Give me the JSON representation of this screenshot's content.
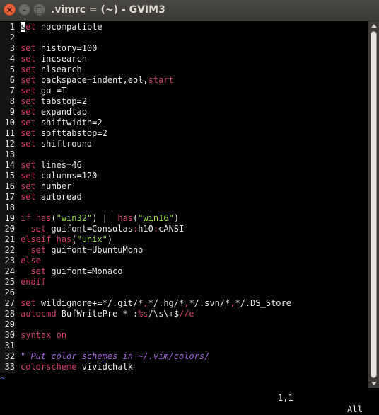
{
  "window": {
    "title": ".vimrc = (~) - GVIM3",
    "close_glyph": "×",
    "minimize_glyph": "–",
    "maximize_glyph": "□"
  },
  "editor": {
    "lines": [
      {
        "n": "1",
        "t": [
          [
            "cur",
            "s"
          ],
          [
            "kw",
            "et"
          ],
          [
            "txt",
            " nocompatible"
          ]
        ]
      },
      {
        "n": "2",
        "t": []
      },
      {
        "n": "3",
        "t": [
          [
            "kw",
            "set"
          ],
          [
            "txt",
            " history=100"
          ]
        ]
      },
      {
        "n": "4",
        "t": [
          [
            "kw",
            "set"
          ],
          [
            "txt",
            " incsearch"
          ]
        ]
      },
      {
        "n": "5",
        "t": [
          [
            "kw",
            "set"
          ],
          [
            "txt",
            " hlsearch"
          ]
        ]
      },
      {
        "n": "6",
        "t": [
          [
            "kw",
            "set"
          ],
          [
            "txt",
            " backspace=indent,eol,"
          ],
          [
            "kw",
            "start"
          ]
        ]
      },
      {
        "n": "7",
        "t": [
          [
            "kw",
            "set"
          ],
          [
            "txt",
            " go-=T"
          ]
        ]
      },
      {
        "n": "8",
        "t": [
          [
            "kw",
            "set"
          ],
          [
            "txt",
            " tabstop=2"
          ]
        ]
      },
      {
        "n": "9",
        "t": [
          [
            "kw",
            "set"
          ],
          [
            "txt",
            " expandtab"
          ]
        ]
      },
      {
        "n": "10",
        "t": [
          [
            "kw",
            "set"
          ],
          [
            "txt",
            " shiftwidth=2"
          ]
        ]
      },
      {
        "n": "11",
        "t": [
          [
            "kw",
            "set"
          ],
          [
            "txt",
            " softtabstop=2"
          ]
        ]
      },
      {
        "n": "12",
        "t": [
          [
            "kw",
            "set"
          ],
          [
            "txt",
            " shiftround"
          ]
        ]
      },
      {
        "n": "13",
        "t": []
      },
      {
        "n": "14",
        "t": [
          [
            "kw",
            "set"
          ],
          [
            "txt",
            " lines=46"
          ]
        ]
      },
      {
        "n": "15",
        "t": [
          [
            "kw",
            "set"
          ],
          [
            "txt",
            " columns=120"
          ]
        ]
      },
      {
        "n": "16",
        "t": [
          [
            "kw",
            "set"
          ],
          [
            "txt",
            " number"
          ]
        ]
      },
      {
        "n": "17",
        "t": [
          [
            "kw",
            "set"
          ],
          [
            "txt",
            " autoread"
          ]
        ]
      },
      {
        "n": "18",
        "t": []
      },
      {
        "n": "19",
        "t": [
          [
            "kw",
            "if"
          ],
          [
            "txt",
            " "
          ],
          [
            "kw",
            "has"
          ],
          [
            "txt",
            "("
          ],
          [
            "str",
            "\"win32\""
          ],
          [
            "txt",
            ") || "
          ],
          [
            "kw",
            "has"
          ],
          [
            "txt",
            "("
          ],
          [
            "str",
            "\"win16\""
          ],
          [
            "txt",
            ")"
          ]
        ]
      },
      {
        "n": "20",
        "t": [
          [
            "txt",
            "  "
          ],
          [
            "kw",
            "set"
          ],
          [
            "txt",
            " guifont=Consolas"
          ],
          [
            "kw",
            ":"
          ],
          [
            "txt",
            "h10"
          ],
          [
            "kw",
            ":"
          ],
          [
            "txt",
            "cANSI"
          ]
        ]
      },
      {
        "n": "21",
        "t": [
          [
            "kw",
            "elseif"
          ],
          [
            "txt",
            " "
          ],
          [
            "kw",
            "has"
          ],
          [
            "txt",
            "("
          ],
          [
            "str",
            "\"unix\""
          ],
          [
            "txt",
            ")"
          ]
        ]
      },
      {
        "n": "22",
        "t": [
          [
            "txt",
            "  "
          ],
          [
            "kw",
            "set"
          ],
          [
            "txt",
            " guifont=UbuntuMono"
          ]
        ]
      },
      {
        "n": "23",
        "t": [
          [
            "kw",
            "else"
          ]
        ]
      },
      {
        "n": "24",
        "t": [
          [
            "txt",
            "  "
          ],
          [
            "kw",
            "set"
          ],
          [
            "txt",
            " guifont=Monaco"
          ]
        ]
      },
      {
        "n": "25",
        "t": [
          [
            "kw",
            "endif"
          ]
        ]
      },
      {
        "n": "26",
        "t": []
      },
      {
        "n": "27",
        "t": [
          [
            "kw",
            "set"
          ],
          [
            "txt",
            " wildignore+=*/.git/*"
          ],
          [
            "kw",
            ","
          ],
          [
            "txt",
            "*/.hg/*"
          ],
          [
            "kw",
            ","
          ],
          [
            "txt",
            "*/.svn/*"
          ],
          [
            "kw",
            ","
          ],
          [
            "txt",
            "*/.DS_Store"
          ]
        ]
      },
      {
        "n": "28",
        "t": [
          [
            "kw",
            "autocmd"
          ],
          [
            "txt",
            " BufWritePre * :"
          ],
          [
            "kw",
            "%s"
          ],
          [
            "txt",
            "/\\s\\+$"
          ],
          [
            "kw",
            "//e"
          ]
        ]
      },
      {
        "n": "29",
        "t": []
      },
      {
        "n": "30",
        "t": [
          [
            "kw",
            "syntax"
          ],
          [
            "txt",
            " "
          ],
          [
            "kw",
            "on"
          ]
        ]
      },
      {
        "n": "31",
        "t": []
      },
      {
        "n": "32",
        "t": [
          [
            "cmt",
            "\" Put color schemes in ~/.vim/colors/"
          ]
        ]
      },
      {
        "n": "33",
        "t": [
          [
            "kw",
            "colorscheme"
          ],
          [
            "txt",
            " vividchalk"
          ]
        ]
      }
    ],
    "tilde": "~"
  },
  "status": {
    "position": "1,1",
    "scroll": "All"
  }
}
